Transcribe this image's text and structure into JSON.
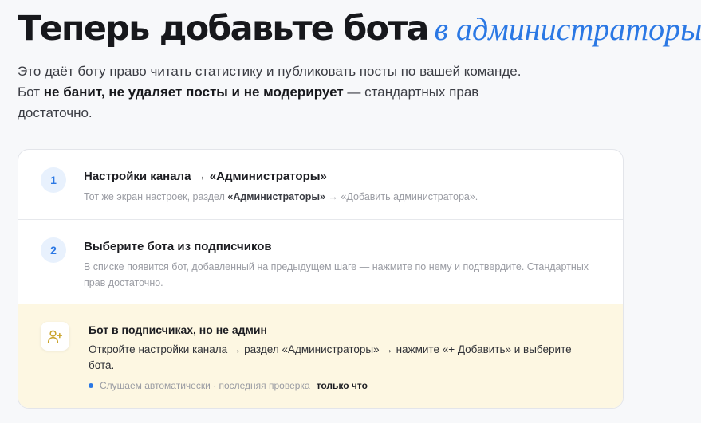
{
  "heading": {
    "main": "Теперь добавьте бота",
    "accent": "в администраторы"
  },
  "intro": {
    "part1": "Это даёт боту право читать статистику и публиковать посты по вашей команде. Бот ",
    "bold": "не банит, не удаляет посты и не модерирует",
    "part2": " — стандартных прав достаточно."
  },
  "steps": [
    {
      "number": "1",
      "title": "Настройки канала → «Администраторы»",
      "desc_prefix": "Тот же экран настроек, раздел ",
      "desc_bold": "«Администраторы»",
      "desc_suffix": " → «Добавить администратора»."
    },
    {
      "number": "2",
      "title": "Выберите бота из подписчиков",
      "desc": "В списке появится бот, добавленный на предыдущем шаге — нажмите по нему и подтвердите. Стандартных прав достаточно."
    }
  ],
  "alert": {
    "icon": "add-user-icon",
    "title": "Бот в подписчиках, но не админ",
    "desc": "Откройте настройки канала → раздел «Администраторы» → нажмите «+ Добавить» и выберите бота.",
    "status_text": "Слушаем автоматически · последняя проверка",
    "status_time": "только что"
  },
  "colors": {
    "accent": "#2b78e4",
    "alert_bg": "#fdf7e2",
    "icon_gold": "#c9a227"
  }
}
